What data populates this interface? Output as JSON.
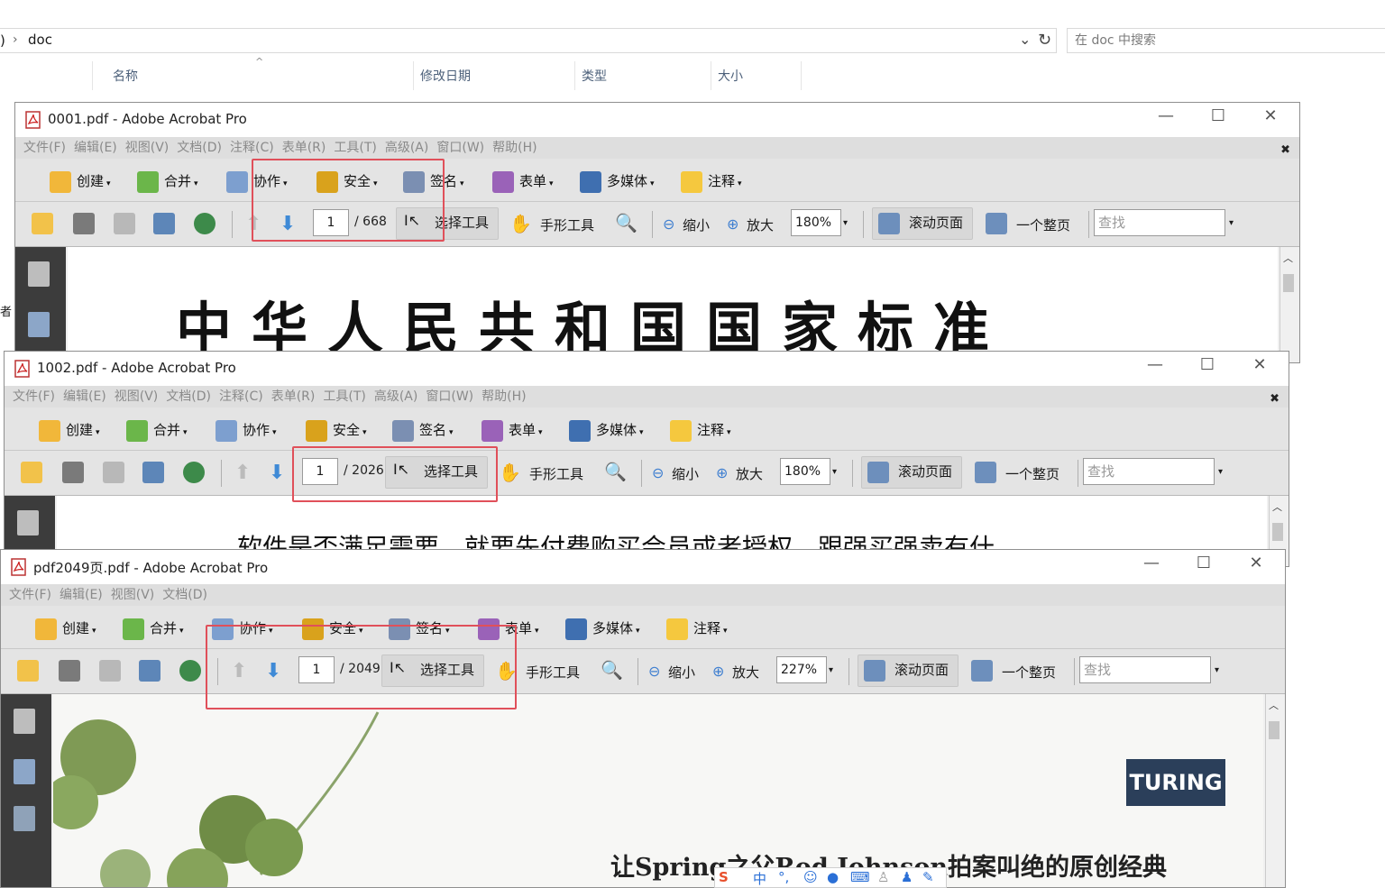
{
  "explorer": {
    "path_prefix": ")",
    "path_sep": "›",
    "path": "doc",
    "search_placeholder": "在 doc 中搜索",
    "columns": [
      "名称",
      "修改日期",
      "类型",
      "大小"
    ],
    "side_text": "者"
  },
  "menus": [
    "文件(F)",
    "编辑(E)",
    "视图(V)",
    "文档(D)",
    "注释(C)",
    "表单(R)",
    "工具(T)",
    "高级(A)",
    "窗口(W)",
    "帮助(H)"
  ],
  "menus_short": [
    "文件(F)",
    "编辑(E)",
    "视图(V)",
    "文档(D)"
  ],
  "toolbar1": {
    "create": "创建",
    "merge": "合并",
    "collab": "协作",
    "secure": "安全",
    "sign": "签名",
    "forms": "表单",
    "media": "多媒体",
    "comment": "注释"
  },
  "toolbar2": {
    "select": "选择工具",
    "hand": "手形工具",
    "zoom_out": "缩小",
    "zoom_in": "放大",
    "scroll": "滚动页面",
    "one_page": "一个整页",
    "find_placeholder": "查找"
  },
  "windows": [
    {
      "title": "0001.pdf - Adobe Acrobat Pro",
      "page": "1",
      "total": "/ 668",
      "zoom": "180%",
      "content": "中华人民共和国国家标准"
    },
    {
      "title": "1002.pdf - Adobe Acrobat Pro",
      "page": "1",
      "total": "/ 2026",
      "zoom": "180%",
      "content": "软件是否满足需要，就要先付费购买会员或者授权，跟强买强卖有什"
    },
    {
      "title": "pdf2049页.pdf - Adobe Acrobat Pro",
      "page": "1",
      "total": "/ 2049",
      "zoom": "227%",
      "content": "让Spring之父Rod Johnson拍案叫绝的原创经典",
      "logo": "TURING"
    }
  ],
  "ime": {
    "lang": "中",
    "punct": "°,"
  },
  "colors": {
    "red_highlight": "#e0505a",
    "nav_pane": "#3c3c3c",
    "toolbar": "#e4e4e4"
  }
}
